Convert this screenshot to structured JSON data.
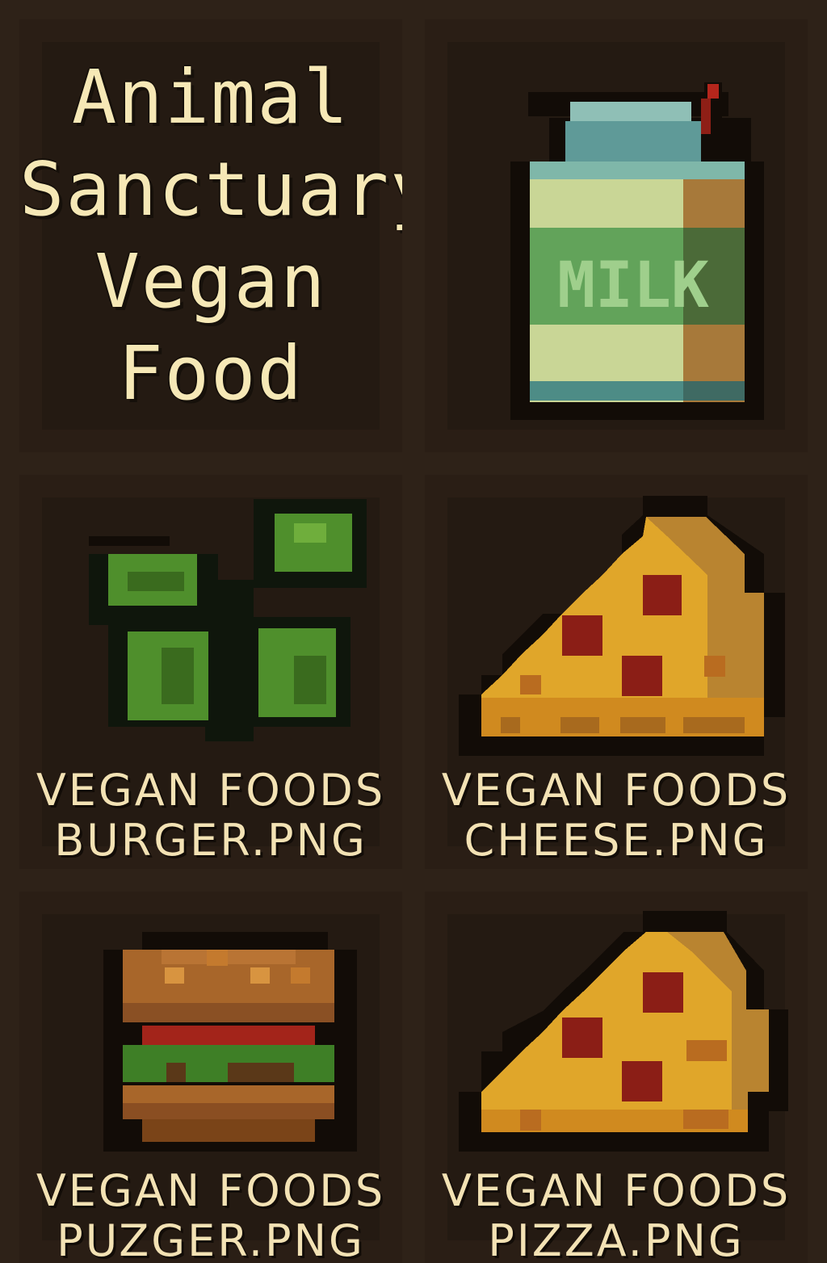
{
  "title": {
    "line1": "Animal",
    "line2": "Sanctuary",
    "line3": "Vegan",
    "line4": "Food"
  },
  "tiles": {
    "milk": {
      "label_text": "MILK",
      "icon": "milk-carton-icon"
    },
    "greens": {
      "icon": "leafy-greens-icon",
      "caption_line1": "VEGAN FOODS",
      "caption_line2": "BURGER.PNG"
    },
    "cheese": {
      "icon": "cheese-wedge-icon",
      "caption_line1": "VEGAN FOODS",
      "caption_line2": "CHEESE.PNG"
    },
    "burger": {
      "icon": "burger-icon",
      "caption_line1": "VEGAN FOODS",
      "caption_line2": "PUZGER.PNG"
    },
    "pizza": {
      "icon": "pizza-slice-icon",
      "caption_line1": "VEGAN FOODS",
      "caption_line2": "PIZZA.PNG"
    }
  },
  "colors": {
    "background": "#2e2218",
    "cell": "#241a12",
    "text": "#f6e8b6",
    "outline": "#120c07"
  }
}
